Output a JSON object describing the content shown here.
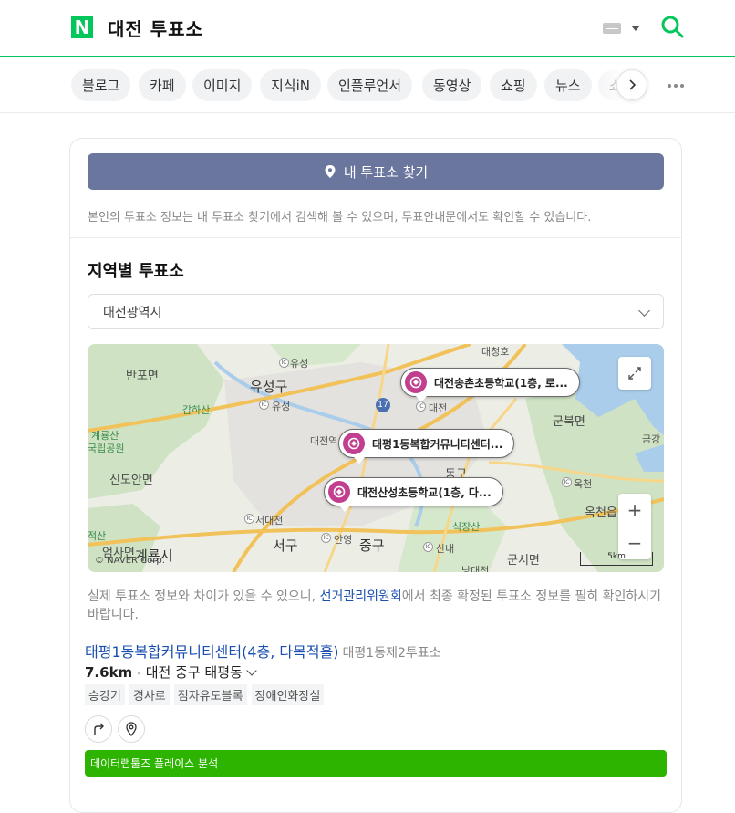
{
  "header": {
    "logo": "N",
    "query": "대전 투표소",
    "colors": {
      "brand": "#03c75a"
    }
  },
  "tabs": {
    "items": [
      "블로그",
      "카페",
      "이미지",
      "지식iN",
      "인플루언서",
      "동영상",
      "쇼핑",
      "뉴스",
      "쇼"
    ]
  },
  "card": {
    "find_button": "내 투표소 찾기",
    "note": "본인의 투표소 정보는 내 투표소 찾기에서 검색해 볼 수 있으며, 투표안내문에서도 확인할 수 있습니다.",
    "section_title": "지역별 투표소",
    "region_select": "대전광역시"
  },
  "map": {
    "labels": {
      "banpo": "반포면",
      "yuseong_gu": "유성구",
      "yuseong_ic": "유성",
      "yuseong_ic2": "유성",
      "gapha": "갑하산",
      "gyeryongsan": "계룡산",
      "gukrip": "국립공원",
      "sindoan": "신도안면",
      "daejeon_ic": "대전",
      "gunbuk": "군북면",
      "geumgang": "금강",
      "dong_gu": "동구",
      "okcheon_ic": "옥천",
      "okcheon_eup": "옥천읍",
      "seo_daejeon": "서대전",
      "seo_gu": "서구",
      "anyeong": "안영",
      "jung_gu": "중구",
      "sikjang": "식장산",
      "sannae": "산내",
      "eomsa": "엄사면",
      "gyeryongsi": "계룡시",
      "gunseo": "군서면",
      "jeoksan": "적산",
      "daejeon_station": "대전역",
      "hwy17": "17",
      "daecheong": "대청호",
      "nangdae": "낭대전"
    },
    "pins": [
      "대전송촌초등학교(1층, 로...",
      "태평1동복합커뮤니티센터...",
      "대전산성초등학교(1층, 다..."
    ],
    "copyright": "© NAVER Corp.",
    "scale": "5km"
  },
  "notice": {
    "before": "실제 투표소 정보와 차이가 있을 수 있으니, ",
    "link": "선거관리위원회",
    "after": "에서 최종 확정된 투표소 정보를 필히 확인하시기 바랍니다."
  },
  "result": {
    "title": "태평1동복합커뮤니티센터(4층, 다목적홀)",
    "subtitle": "태평1동제2투표소",
    "distance": "7.6km",
    "address": "대전 중구 태평동",
    "tags": [
      "승강기",
      "경사로",
      "점자유도블록",
      "장애인화장실"
    ]
  },
  "datalab_bar": "데이터랩툴즈 플레이스 분석"
}
